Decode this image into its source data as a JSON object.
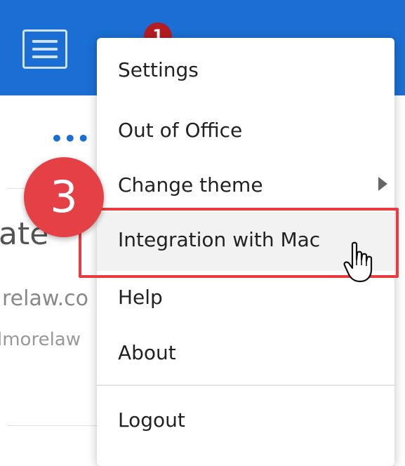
{
  "header": {
    "notification_count": "1"
  },
  "background": {
    "more_label": "•••",
    "name_fragment": "ate",
    "email_fragment_1": "relaw.co",
    "email_fragment_2": "lmorelaw"
  },
  "menu": {
    "items": [
      {
        "label": "Settings"
      },
      {
        "label": "Out of Office"
      },
      {
        "label": "Change theme"
      },
      {
        "label": "Integration with Mac"
      },
      {
        "label": "Help"
      },
      {
        "label": "About"
      },
      {
        "label": "Logout"
      }
    ]
  },
  "annotation": {
    "step_number": "3",
    "highlight_color": "#e83c41"
  },
  "colors": {
    "topbar": "#1b6fd4",
    "badge": "#b31d22",
    "step_badge": "#e64047"
  },
  "icons": {
    "menu_toggle": "hamburger-icon",
    "submenu": "chevron-right-icon",
    "pointer": "hand-pointer-icon"
  }
}
